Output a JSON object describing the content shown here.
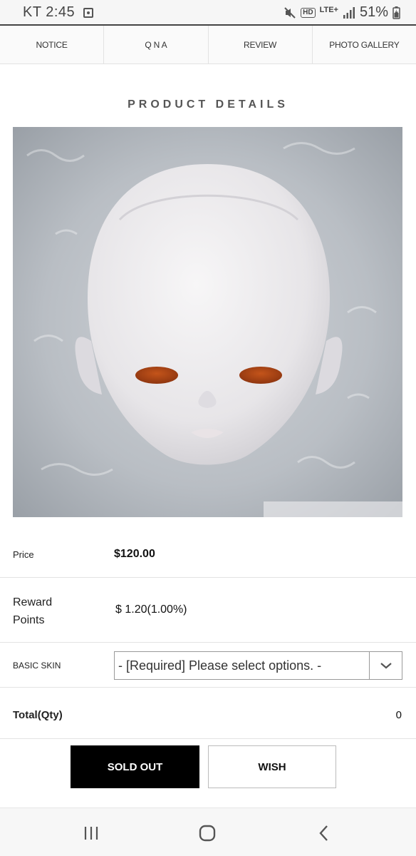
{
  "status_bar": {
    "carrier_time": "KT 2:45",
    "lte": "LTE+",
    "hd": "HD",
    "battery_pct": "51%",
    "icons": [
      "notification-icon",
      "mute-icon",
      "hd-icon",
      "lte-icon",
      "signal-icon",
      "battery-icon"
    ]
  },
  "tabs": [
    "NOTICE",
    "Q N A",
    "REVIEW",
    "PHOTO GALLERY"
  ],
  "section_title": "PRODUCT DETAILS",
  "product": {
    "price_label": "Price",
    "price_value": "$120.00",
    "reward_label": "Reward Points",
    "reward_value": "$ 1.20(1.00%)",
    "option_label": "BASIC SKIN",
    "option_selected": "- [Required] Please select options. -",
    "total_label": "Total(Qty)",
    "total_value": "0"
  },
  "buttons": {
    "sold_out": "SOLD OUT",
    "wish": "WISH"
  },
  "nav": {
    "icons": [
      "recent-apps-icon",
      "home-icon",
      "back-icon"
    ]
  }
}
